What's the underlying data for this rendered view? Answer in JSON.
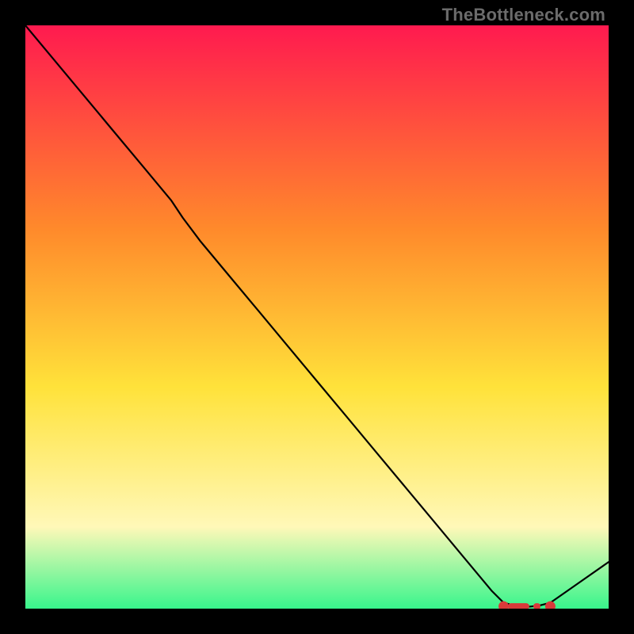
{
  "watermark": "TheBottleneck.com",
  "chart_data": {
    "type": "line",
    "title": "",
    "xlabel": "",
    "ylabel": "",
    "xlim": [
      0,
      100
    ],
    "ylim": [
      0,
      100
    ],
    "x": [
      0,
      5,
      10,
      15,
      20,
      25,
      27,
      30,
      35,
      40,
      45,
      50,
      55,
      60,
      65,
      70,
      75,
      80,
      82,
      84,
      86,
      88,
      90,
      95,
      100
    ],
    "values": [
      100,
      94,
      88,
      82,
      76,
      70,
      67,
      63,
      57,
      51,
      45,
      39,
      33,
      27,
      21,
      15,
      9,
      3,
      1,
      0.5,
      0.3,
      0.5,
      1,
      4.5,
      8
    ],
    "markers": {
      "type": "flat-band",
      "x_start": 82,
      "x_end": 90,
      "y": 0.4
    },
    "colors": {
      "gradient_top": "#ff1a4f",
      "gradient_mid1": "#ff8a2b",
      "gradient_mid2": "#ffe23a",
      "gradient_low": "#fff8b8",
      "gradient_bottom": "#38f58c",
      "line": "#000000",
      "marker": "#d83a3a",
      "frame_bg": "#000000"
    }
  }
}
